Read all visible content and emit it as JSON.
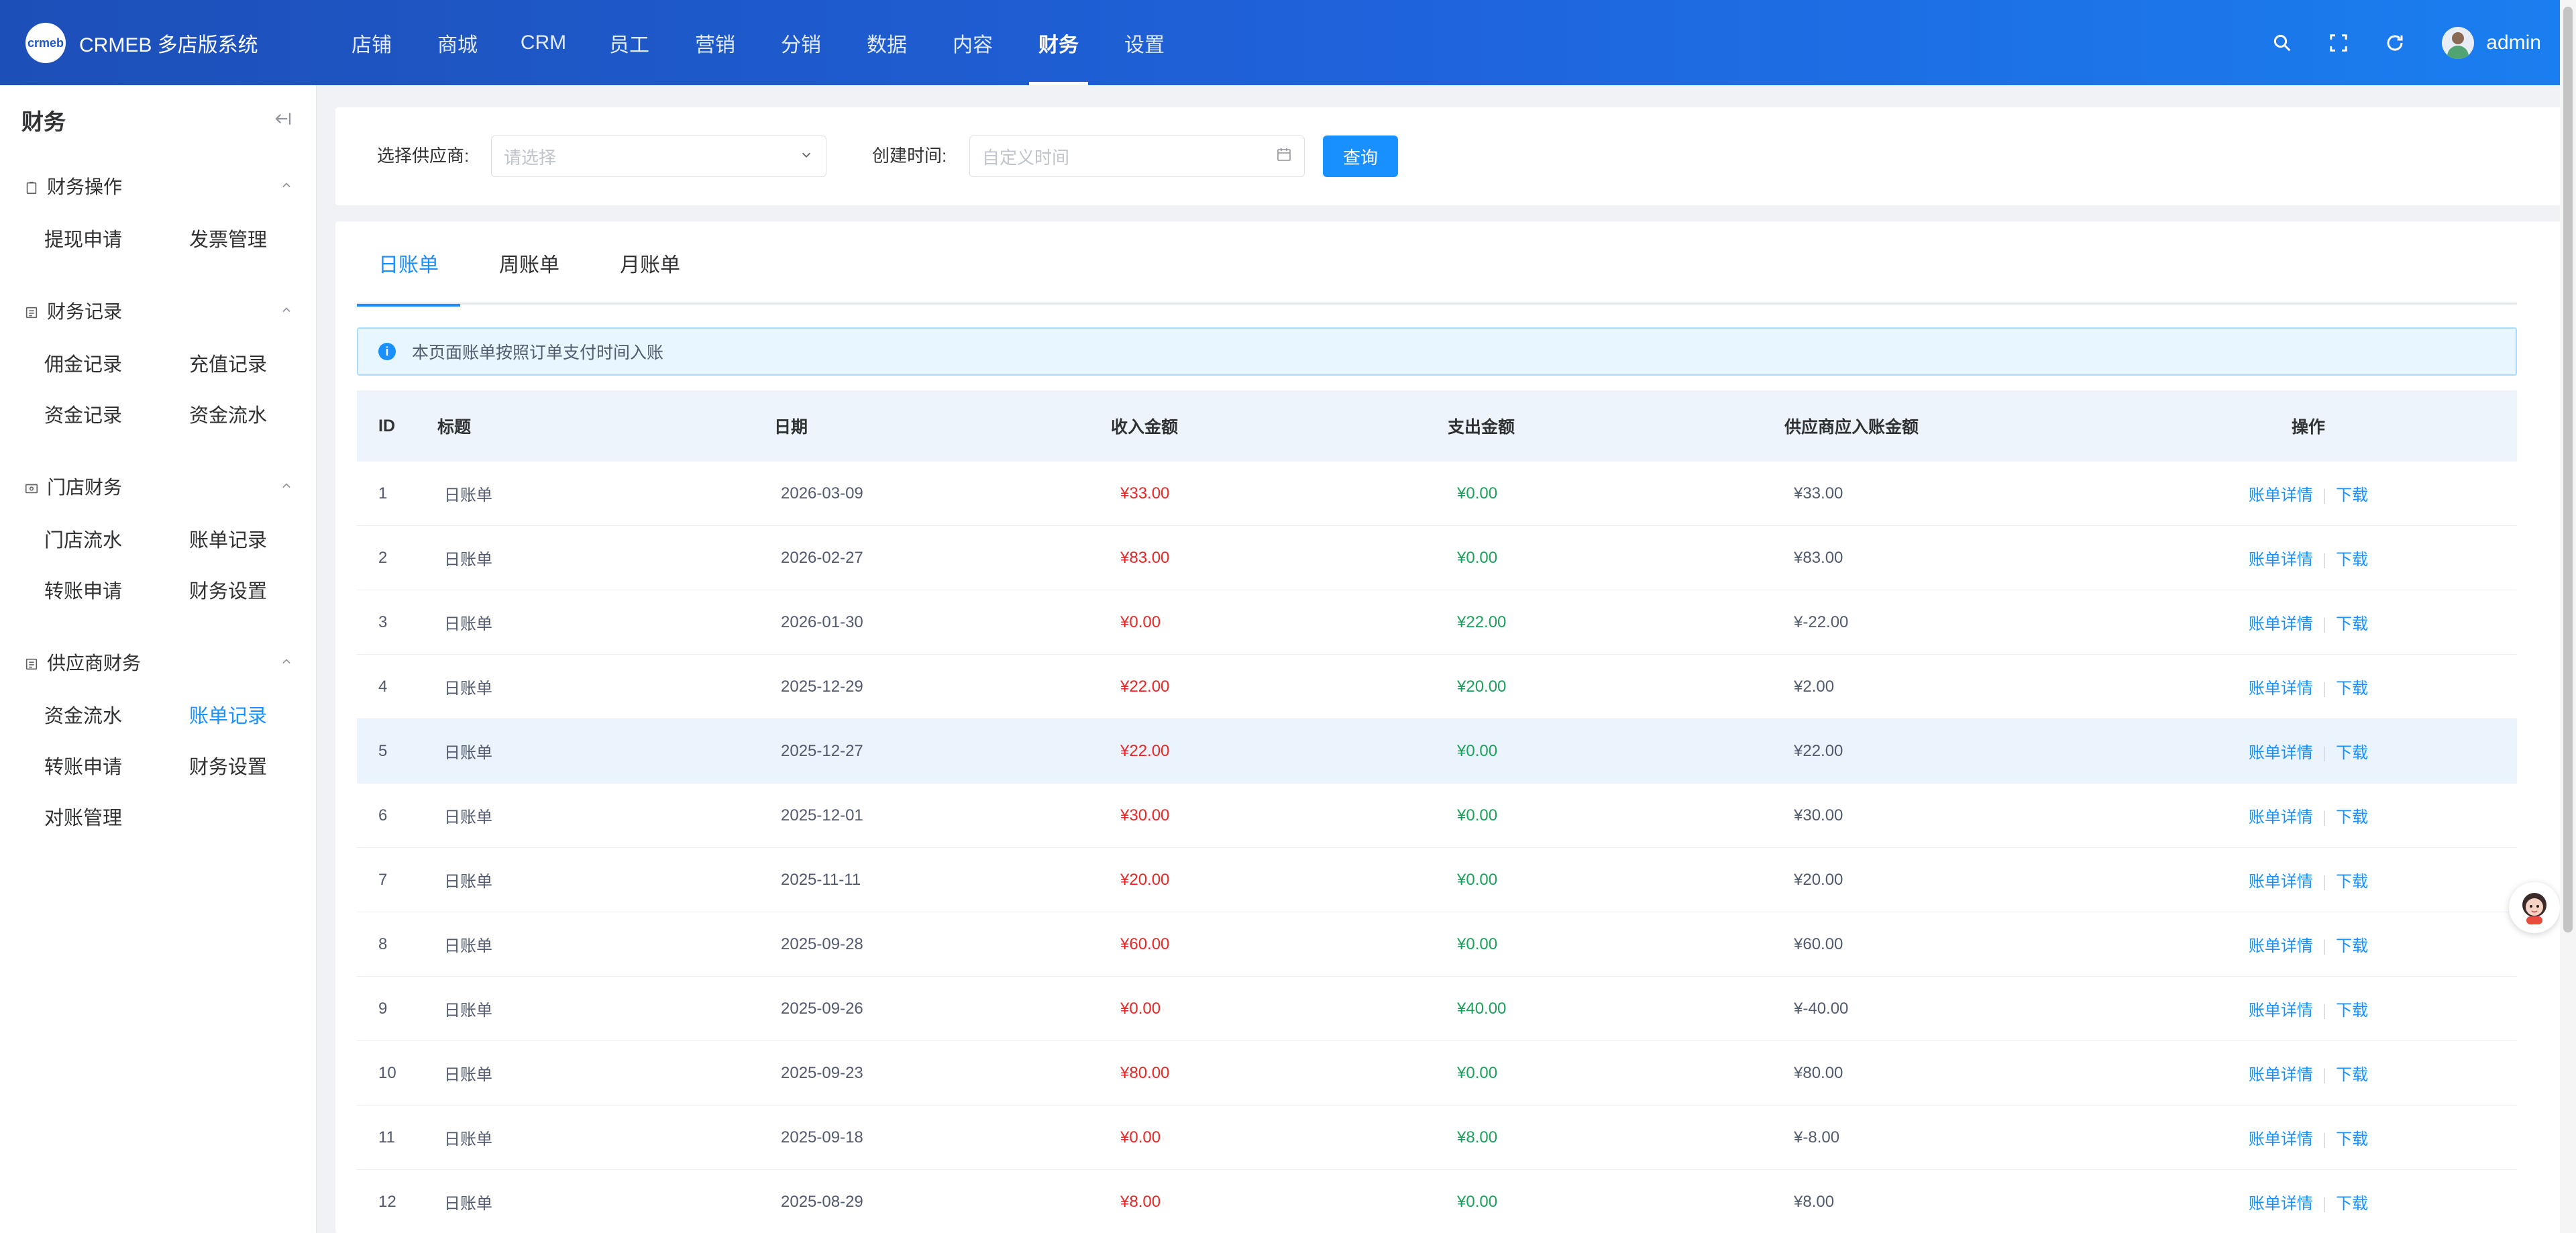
{
  "app": {
    "title": "CRMEB 多店版系统",
    "logo_text": "crmeb"
  },
  "topnav": [
    {
      "label": "店铺",
      "active": false
    },
    {
      "label": "商城",
      "active": false
    },
    {
      "label": "CRM",
      "active": false
    },
    {
      "label": "员工",
      "active": false
    },
    {
      "label": "营销",
      "active": false
    },
    {
      "label": "分销",
      "active": false
    },
    {
      "label": "数据",
      "active": false
    },
    {
      "label": "内容",
      "active": false
    },
    {
      "label": "财务",
      "active": true
    },
    {
      "label": "设置",
      "active": false
    }
  ],
  "user": {
    "name": "admin"
  },
  "sidebar": {
    "title": "财务",
    "groups": [
      {
        "label": "财务操作",
        "icon": "clipboard-icon",
        "items": [
          "提现申请",
          "发票管理"
        ]
      },
      {
        "label": "财务记录",
        "icon": "list-icon",
        "items": [
          "佣金记录",
          "充值记录",
          "资金记录",
          "资金流水"
        ]
      },
      {
        "label": "门店财务",
        "icon": "wallet-icon",
        "items": [
          "门店流水",
          "账单记录",
          "转账申请",
          "财务设置"
        ]
      },
      {
        "label": "供应商财务",
        "icon": "list-icon",
        "items": [
          "资金流水",
          "账单记录",
          "转账申请",
          "财务设置",
          "对账管理"
        ],
        "active_item": "账单记录"
      }
    ]
  },
  "filters": {
    "supplier_label": "选择供应商:",
    "supplier_placeholder": "请选择",
    "time_label": "创建时间:",
    "time_placeholder": "自定义时间",
    "query_button": "查询"
  },
  "tabs": [
    {
      "label": "日账单",
      "active": true
    },
    {
      "label": "周账单",
      "active": false
    },
    {
      "label": "月账单",
      "active": false
    }
  ],
  "notice": "本页面账单按照订单支付时间入账",
  "table": {
    "columns": [
      "ID",
      "标题",
      "日期",
      "收入金额",
      "支出金额",
      "供应商应入账金额",
      "操作"
    ],
    "rows": [
      {
        "id": "1",
        "title": "日账单",
        "date": "2026-03-09",
        "income": "¥33.00",
        "expense": "¥0.00",
        "due": "¥33.00"
      },
      {
        "id": "2",
        "title": "日账单",
        "date": "2026-02-27",
        "income": "¥83.00",
        "expense": "¥0.00",
        "due": "¥83.00"
      },
      {
        "id": "3",
        "title": "日账单",
        "date": "2026-01-30",
        "income": "¥0.00",
        "expense": "¥22.00",
        "due": "¥-22.00"
      },
      {
        "id": "4",
        "title": "日账单",
        "date": "2025-12-29",
        "income": "¥22.00",
        "expense": "¥20.00",
        "due": "¥2.00"
      },
      {
        "id": "5",
        "title": "日账单",
        "date": "2025-12-27",
        "income": "¥22.00",
        "expense": "¥0.00",
        "due": "¥22.00"
      },
      {
        "id": "6",
        "title": "日账单",
        "date": "2025-12-01",
        "income": "¥30.00",
        "expense": "¥0.00",
        "due": "¥30.00"
      },
      {
        "id": "7",
        "title": "日账单",
        "date": "2025-11-11",
        "income": "¥20.00",
        "expense": "¥0.00",
        "due": "¥20.00"
      },
      {
        "id": "8",
        "title": "日账单",
        "date": "2025-09-28",
        "income": "¥60.00",
        "expense": "¥0.00",
        "due": "¥60.00"
      },
      {
        "id": "9",
        "title": "日账单",
        "date": "2025-09-26",
        "income": "¥0.00",
        "expense": "¥40.00",
        "due": "¥-40.00"
      },
      {
        "id": "10",
        "title": "日账单",
        "date": "2025-09-23",
        "income": "¥80.00",
        "expense": "¥0.00",
        "due": "¥80.00"
      },
      {
        "id": "11",
        "title": "日账单",
        "date": "2025-09-18",
        "income": "¥0.00",
        "expense": "¥8.00",
        "due": "¥-8.00"
      },
      {
        "id": "12",
        "title": "日账单",
        "date": "2025-08-29",
        "income": "¥8.00",
        "expense": "¥0.00",
        "due": "¥8.00"
      }
    ],
    "actions": {
      "detail": "账单详情",
      "download": "下载"
    },
    "hover_row": "5"
  },
  "colors": {
    "accent": "#1890ff",
    "income": "#ed2525",
    "expense": "#19a35a"
  }
}
